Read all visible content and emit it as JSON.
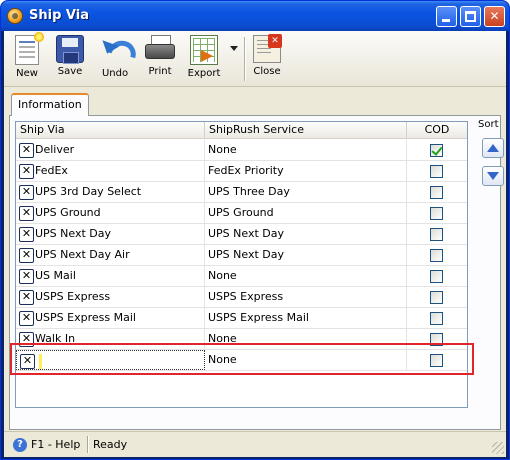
{
  "window": {
    "title": "Ship Via"
  },
  "toolbar": {
    "new_label": "New",
    "save_label": "Save",
    "undo_label": "Undo",
    "print_label": "Print",
    "export_label": "Export",
    "close_label": "Close"
  },
  "tabs": [
    {
      "label": "Information",
      "active": true
    }
  ],
  "grid": {
    "columns": [
      "Ship Via",
      "ShipRush Service",
      "COD"
    ],
    "rows": [
      {
        "ship_via": "Deliver",
        "service": "None",
        "cod": true
      },
      {
        "ship_via": "FedEx",
        "service": "FedEx Priority",
        "cod": false
      },
      {
        "ship_via": "UPS 3rd Day Select",
        "service": "UPS Three Day",
        "cod": false
      },
      {
        "ship_via": "UPS Ground",
        "service": "UPS Ground",
        "cod": false
      },
      {
        "ship_via": "UPS Next Day",
        "service": "UPS Next Day",
        "cod": false
      },
      {
        "ship_via": "UPS Next Day Air",
        "service": "UPS Next Day",
        "cod": false
      },
      {
        "ship_via": "US Mail",
        "service": "None",
        "cod": false
      },
      {
        "ship_via": "USPS Express",
        "service": "USPS Express",
        "cod": false
      },
      {
        "ship_via": "USPS Express Mail",
        "service": "USPS Express Mail",
        "cod": false
      },
      {
        "ship_via": "Walk In",
        "service": "None",
        "cod": false
      }
    ],
    "new_row": {
      "ship_via": "",
      "service": "None",
      "cod": false
    },
    "delete_glyph": "✕"
  },
  "sort": {
    "label": "Sort"
  },
  "status": {
    "help": "F1 - Help",
    "state": "Ready",
    "help_glyph": "?"
  },
  "colors": {
    "titlebar": "#0a54e3",
    "highlight": "#e0262b",
    "cod_check": "#21a121"
  },
  "icons": [
    "app-icon",
    "new-icon",
    "save-icon",
    "undo-icon",
    "print-icon",
    "export-icon",
    "close-icon",
    "help-icon"
  ]
}
